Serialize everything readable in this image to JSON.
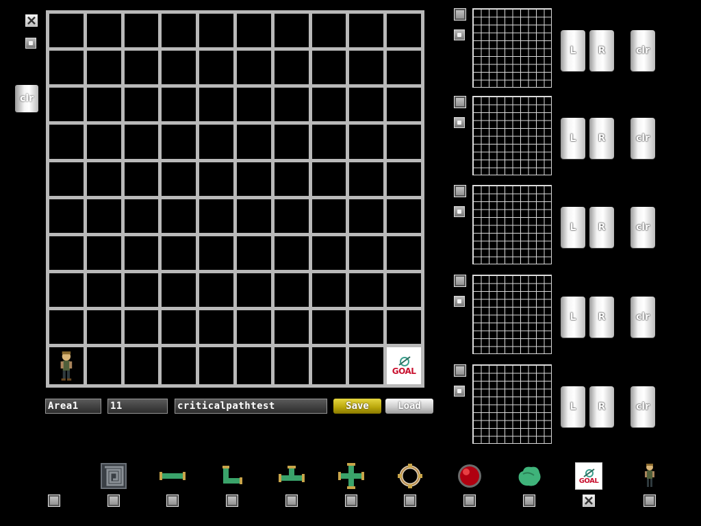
{
  "left_panel": {
    "clear_label": "clr"
  },
  "main_grid": {
    "rows": 10,
    "cols": 10,
    "start_icon": "character-sprite",
    "goal_label": "GOAL"
  },
  "form": {
    "area_value": "Area1",
    "number_value": "11",
    "name_value": "criticalpathtest",
    "save_label": "Save",
    "load_label": "Load"
  },
  "layers": [
    {
      "left_label": "L",
      "right_label": "R",
      "clear_label": "clr"
    },
    {
      "left_label": "L",
      "right_label": "R",
      "clear_label": "clr"
    },
    {
      "left_label": "L",
      "right_label": "R",
      "clear_label": "clr"
    },
    {
      "left_label": "L",
      "right_label": "R",
      "clear_label": "clr"
    },
    {
      "left_label": "L",
      "right_label": "R",
      "clear_label": "clr"
    }
  ],
  "palette": [
    {
      "icon": "empty",
      "checked": false
    },
    {
      "icon": "maze-block-icon",
      "checked": false
    },
    {
      "icon": "straight-pipe-icon",
      "checked": false
    },
    {
      "icon": "elbow-pipe-icon",
      "checked": false
    },
    {
      "icon": "tee-pipe-icon",
      "checked": false
    },
    {
      "icon": "cross-pipe-icon",
      "checked": false
    },
    {
      "icon": "ring-valve-icon",
      "checked": false
    },
    {
      "icon": "red-orb-icon",
      "checked": false
    },
    {
      "icon": "green-bush-icon",
      "checked": false
    },
    {
      "icon": "goal-icon",
      "checked": true,
      "label": "GOAL"
    },
    {
      "icon": "character-icon",
      "checked": false
    }
  ],
  "colors": {
    "background": "#000000",
    "grid_line": "#b9b9b9",
    "pipe_green": "#3aa36a",
    "pipe_gold": "#c9a54a",
    "save_yellow": "#c9b41a",
    "goal_red": "#c8102e"
  }
}
